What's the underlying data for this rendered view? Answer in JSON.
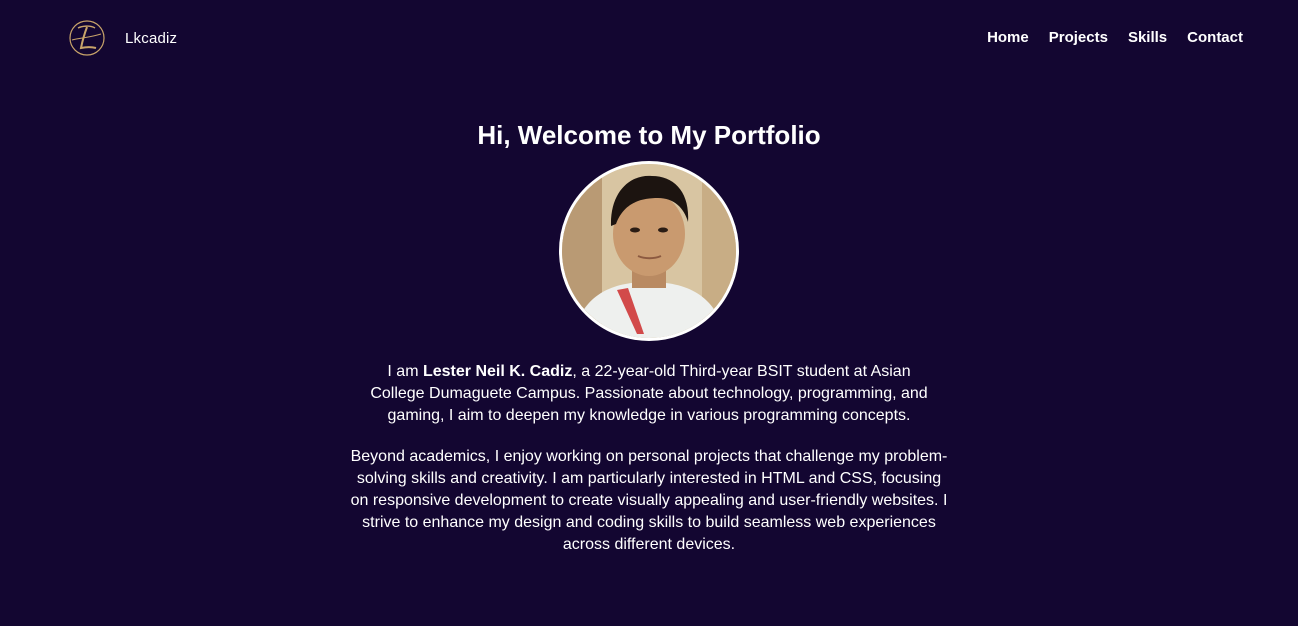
{
  "brand": {
    "logo_icon": "lc-monogram-icon",
    "name": "Lkcadiz"
  },
  "nav": {
    "items": [
      {
        "label": "Home"
      },
      {
        "label": "Projects"
      },
      {
        "label": "Skills"
      },
      {
        "label": "Contact"
      }
    ]
  },
  "hero": {
    "title": "Hi, Welcome to My Portfolio",
    "bio1_prefix": "I am ",
    "bio1_name": "Lester Neil K. Cadiz",
    "bio1_rest": ", a 22-year-old Third-year BSIT student at Asian College Dumaguete Campus. Passionate about technology, programming, and gaming, I aim to deepen my knowledge in various programming concepts.",
    "bio2": "Beyond academics, I enjoy working on personal projects that challenge my problem-solving skills and creativity. I am particularly interested in HTML and CSS, focusing on responsive development to create visually appealing and user-friendly websites. I strive to enhance my design and coding skills to build seamless web experiences across different devices."
  },
  "colors": {
    "background": "#130631",
    "text": "#ffffff",
    "logo_gold": "#c9a46a"
  }
}
